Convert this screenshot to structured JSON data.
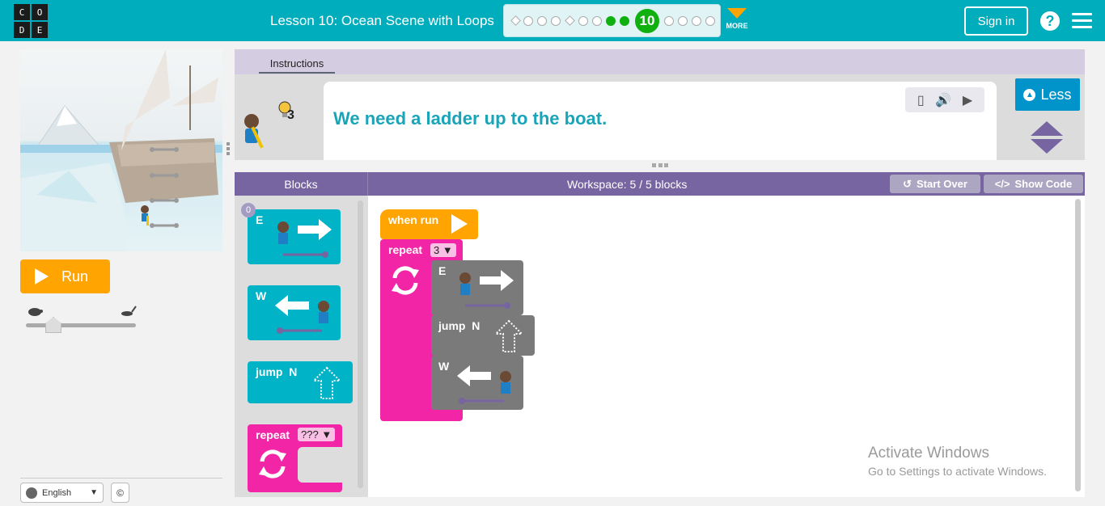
{
  "header": {
    "logo_letters": [
      "C",
      "O",
      "D",
      "E"
    ],
    "lesson_title": "Lesson 10: Ocean Scene with Loops",
    "current_level": "10",
    "more_label": "MORE",
    "signin_label": "Sign in",
    "help_label": "?",
    "progress_colors": {
      "done": "#11b011",
      "bar_bg": "#00adbc"
    }
  },
  "left": {
    "run_label": "Run",
    "language": "English",
    "copyright_label": "©"
  },
  "instructions": {
    "tab_label": "Instructions",
    "hint_count": "3",
    "text": "We need a ladder up to the boat.",
    "less_label": "Less"
  },
  "blocks_panel": {
    "title": "Blocks",
    "badge_count": "0",
    "items": [
      {
        "label": "E",
        "direction": "east"
      },
      {
        "label": "W",
        "direction": "west"
      },
      {
        "label": "jump  N",
        "direction": "north"
      },
      {
        "label": "repeat",
        "dropdown": "???"
      }
    ]
  },
  "workspace": {
    "title": "Workspace: 5 / 5 blocks",
    "start_over_label": "Start Over",
    "show_code_label": "Show Code",
    "when_run_label": "when run",
    "repeat_label": "repeat",
    "repeat_count": "3",
    "inner_blocks": [
      "E",
      "jump  N",
      "W"
    ]
  },
  "watermark": {
    "line1": "Activate Windows",
    "line2": "Go to Settings to activate Windows."
  },
  "colors": {
    "teal": "#00adbc",
    "orange": "#ffa400",
    "purple": "#7665a0",
    "pink": "#f225a6",
    "cyan_block": "#00b3c7",
    "gray_block": "#7a7a7a"
  }
}
